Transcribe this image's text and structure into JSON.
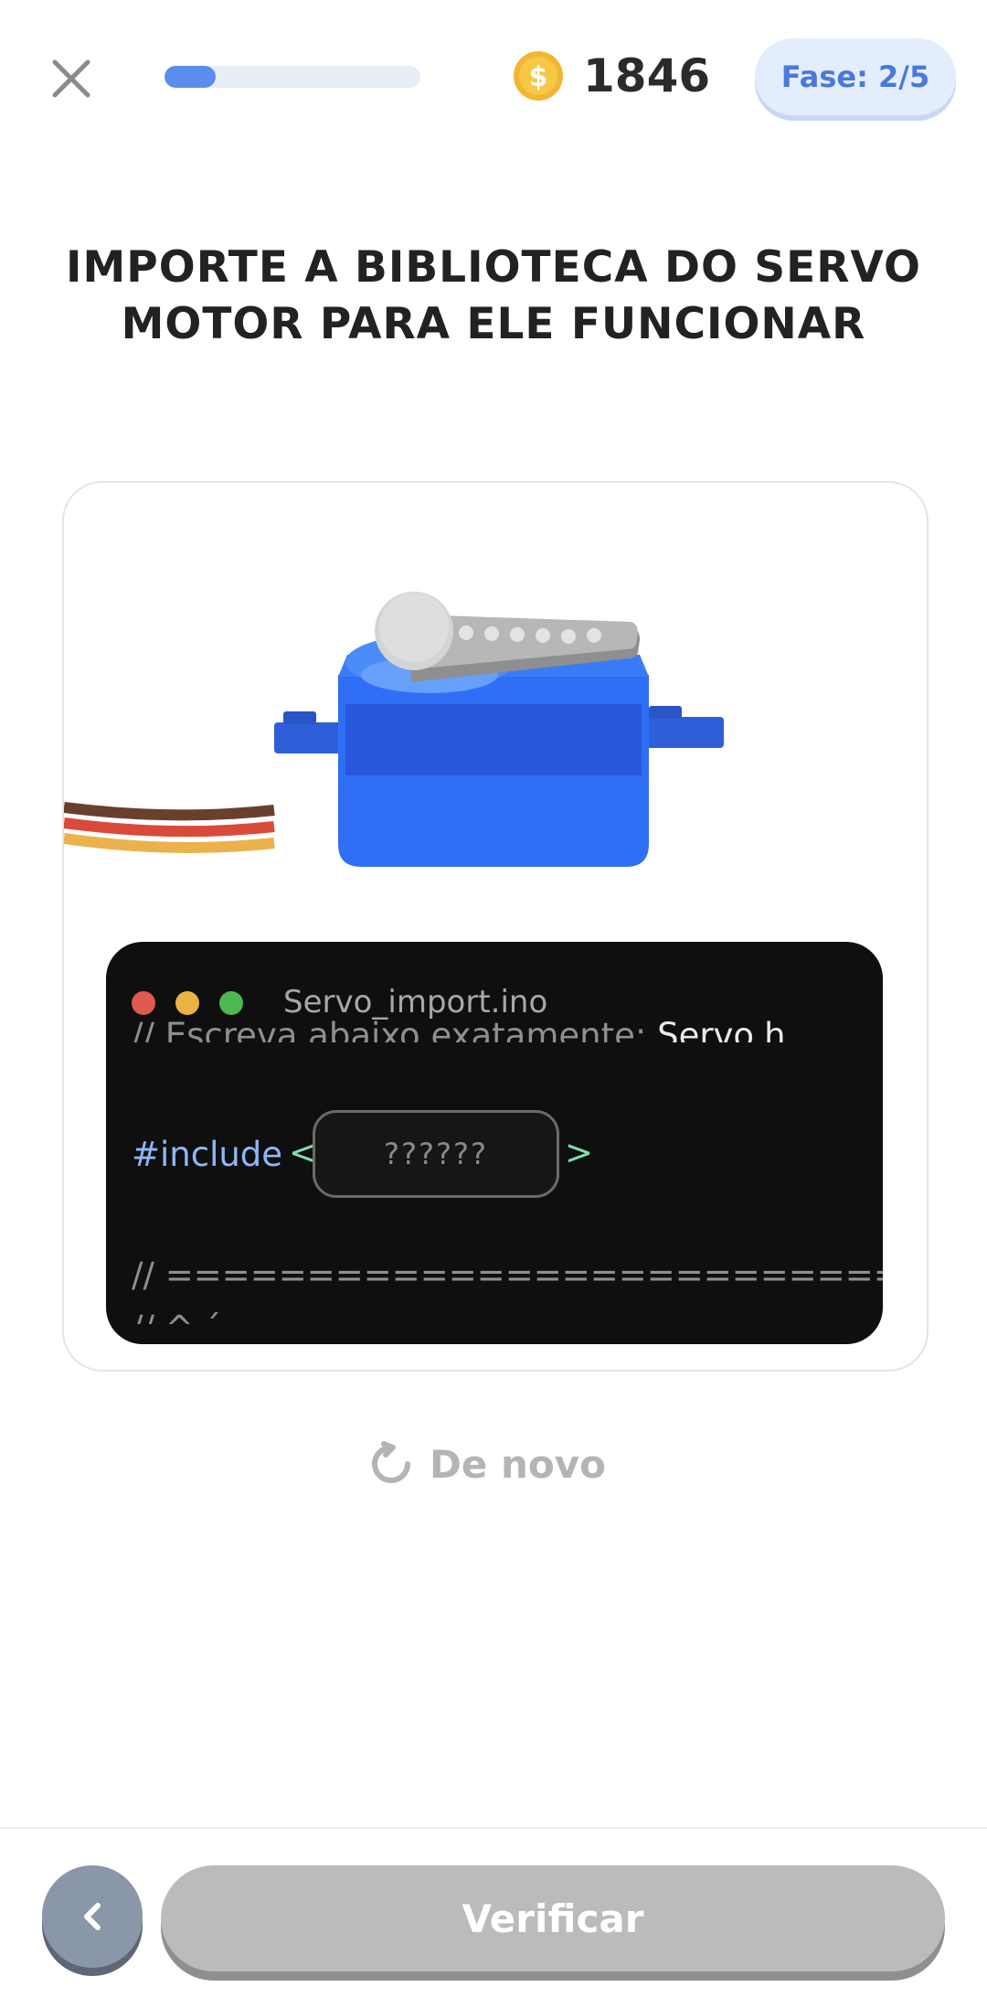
{
  "header": {
    "close_icon": "close-icon",
    "progress_fraction": 0.2,
    "progress_color": "#5b8def",
    "coin_icon": "coin-icon",
    "coins": "1846",
    "fase": "Fase: 2/5"
  },
  "title": {
    "line1": "IMPORTE A BIBLIOTECA DO SERVO",
    "line2": "MOTOR PARA ELE FUNCIONAR"
  },
  "illustration": {
    "name": "servo-motor-illustration"
  },
  "code_window": {
    "filename": "Servo_import.ino",
    "comment_partial": "// Escreva abaixo exatamente:",
    "comment_highlight": "Servo.h",
    "include_keyword": "#include",
    "open_angle": "<",
    "close_angle": ">",
    "input_placeholder": "??????",
    "separator": "// ==========================",
    "cut_line": "// ^            ´"
  },
  "retry": {
    "label": "De novo",
    "icon": "refresh-icon"
  },
  "footer": {
    "back_icon": "chevron-left-icon",
    "verify_label": "Verificar"
  },
  "colors": {
    "accent_blue": "#4a78db",
    "servo_blue": "#2f6ff5",
    "code_bg": "#0f0f0f",
    "button_disabled": "#bbbbbb"
  }
}
